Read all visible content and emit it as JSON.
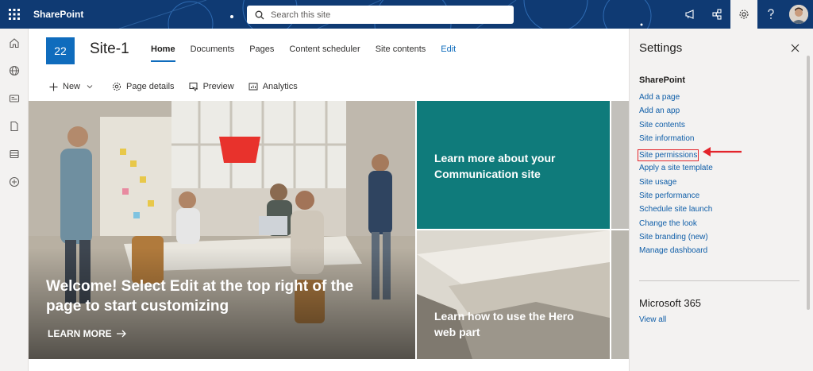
{
  "suitebar": {
    "brand": "SharePoint",
    "search_placeholder": "Search this site",
    "icons": [
      "megaphone-icon",
      "share-network-icon",
      "gear-icon",
      "help-icon"
    ]
  },
  "appbar": {
    "icons": [
      "home-icon",
      "globe-icon",
      "news-icon",
      "file-icon",
      "list-icon",
      "add-circle-icon"
    ]
  },
  "site": {
    "logo_text": "22",
    "title": "Site-1",
    "nav": [
      {
        "label": "Home",
        "active": true
      },
      {
        "label": "Documents"
      },
      {
        "label": "Pages"
      },
      {
        "label": "Content scheduler"
      },
      {
        "label": "Site contents"
      },
      {
        "label": "Edit"
      }
    ]
  },
  "commandbar": {
    "new": "New",
    "page_details": "Page details",
    "preview": "Preview",
    "analytics": "Analytics"
  },
  "hero": {
    "main_title": "Welcome! Select Edit at the top right of the page to start customizing",
    "main_link": "LEARN MORE",
    "tile1": "Learn more about your Communication site",
    "tile2": "Learn how to use the Hero web part"
  },
  "settings": {
    "title": "Settings",
    "sharepoint_heading": "SharePoint",
    "links": [
      "Add a page",
      "Add an app",
      "Site contents",
      "Site information",
      "Site permissions",
      "Apply a site template",
      "Site usage",
      "Site performance",
      "Schedule site launch",
      "Change the look",
      "Site branding (new)",
      "Manage dashboard"
    ],
    "highlighted": "Site permissions",
    "ms365_heading": "Microsoft 365",
    "view_all": "View all"
  },
  "colors": {
    "suitebar": "#0f3a73",
    "accent": "#0f6cbd",
    "teal_tile": "#0f7b7b",
    "highlight": "#e3242b"
  }
}
